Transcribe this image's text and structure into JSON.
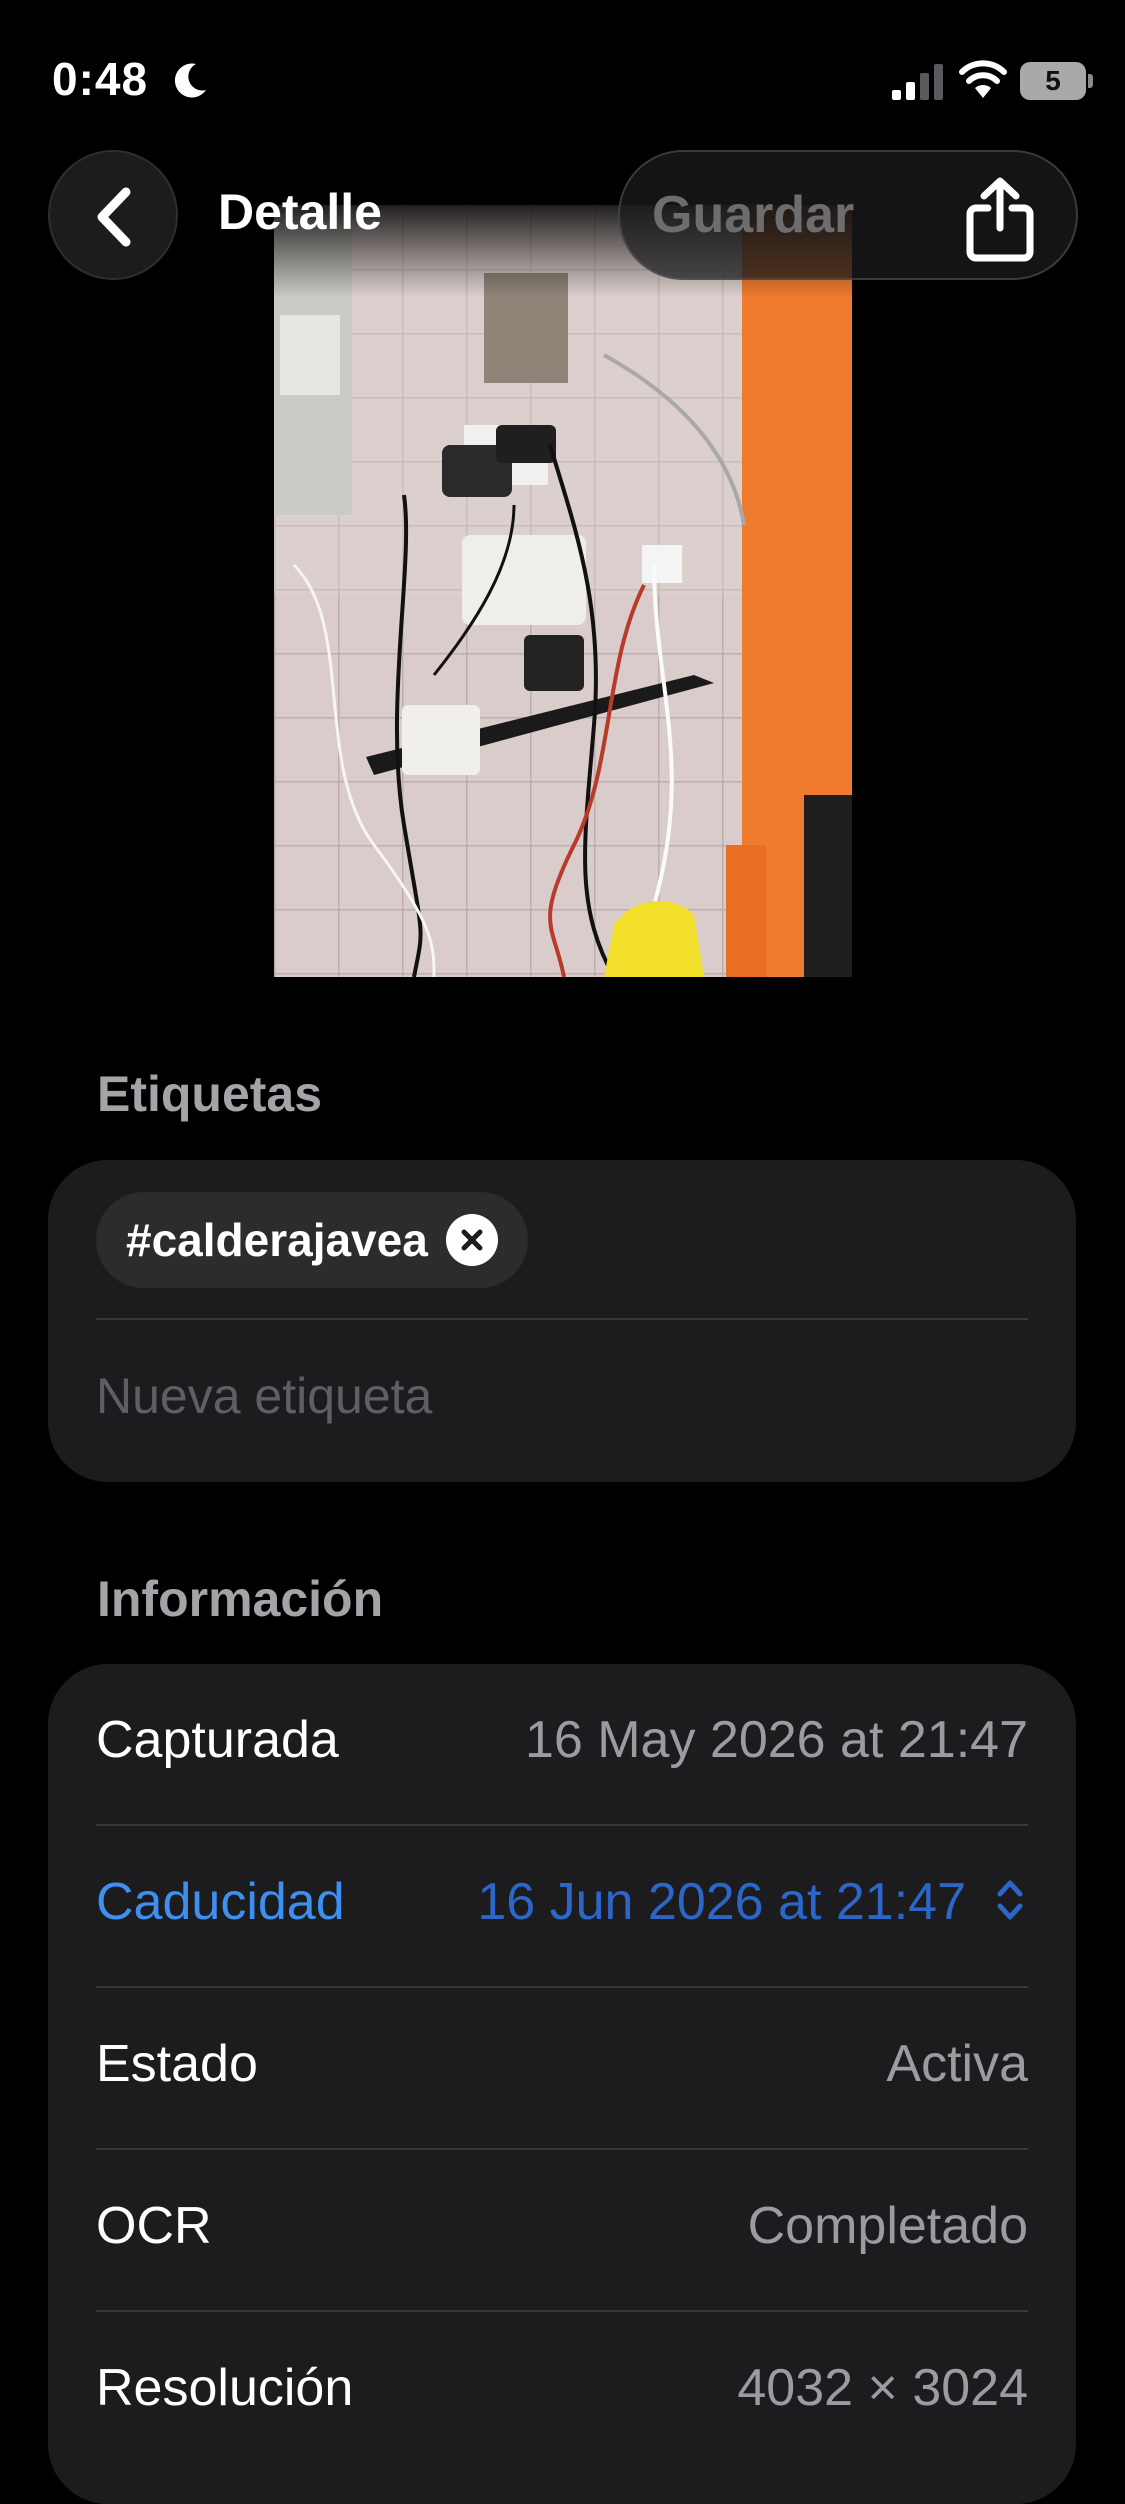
{
  "status_bar": {
    "time": "0:48",
    "battery_level": "5",
    "icons": [
      "moon-icon",
      "signal-icon",
      "wifi-icon",
      "battery-icon"
    ]
  },
  "nav": {
    "title": "Detalle",
    "save_label": "Guardar",
    "icons": [
      "chevron-left-icon",
      "share-icon"
    ]
  },
  "tags": {
    "section_title": "Etiquetas",
    "items": [
      {
        "label": "#calderajavea"
      }
    ],
    "new_tag_placeholder": "Nueva etiqueta"
  },
  "info": {
    "section_title": "Información",
    "rows": [
      {
        "label": "Capturada",
        "value": "16 May 2026 at 21:47"
      },
      {
        "label": "Caducidad",
        "value": "16 Jun 2026 at 21:47"
      },
      {
        "label": "Estado",
        "value": "Activa"
      },
      {
        "label": "OCR",
        "value": "Completado"
      },
      {
        "label": "Resolución",
        "value": "4032 × 3024"
      }
    ]
  },
  "colors": {
    "background": "#000000",
    "card": "#1c1c1e",
    "accent_blue": "#3d8ff0",
    "secondary_text": "#9c9ca0"
  }
}
